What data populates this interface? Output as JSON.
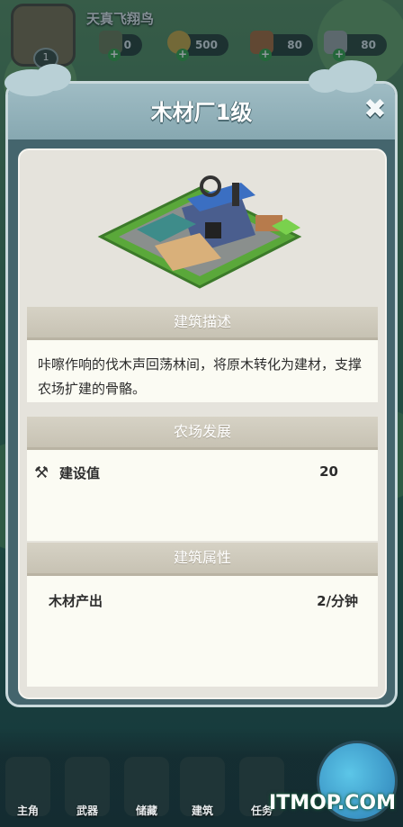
{
  "hud": {
    "player_name": "天真飞翔鸟",
    "level": "1",
    "resources": [
      {
        "icon": "bag-icon",
        "value": "0"
      },
      {
        "icon": "coin-icon",
        "value": "500"
      },
      {
        "icon": "wood-icon",
        "value": "80"
      },
      {
        "icon": "stone-icon",
        "value": "80"
      }
    ]
  },
  "modal": {
    "title": "木材厂1级",
    "close_icon": "close-icon",
    "sections": {
      "description": {
        "header": "建筑描述",
        "text": "咔嚓作响的伐木声回荡林间，将原木转化为建材，支撑农场扩建的骨骼。"
      },
      "development": {
        "header": "农场发展",
        "icon": "hammer-wrench-icon",
        "label": "建设值",
        "value": "20"
      },
      "attributes": {
        "header": "建筑属性",
        "label": "木材产出",
        "value": "2/分钟"
      }
    }
  },
  "nav": {
    "items": [
      "主角",
      "武器",
      "储藏",
      "建筑",
      "任务"
    ]
  },
  "watermark": "ITMOP.COM",
  "colors": {
    "panel_bg": "#e5e3dc",
    "section_header": "#c7c2b3",
    "modal_frame": "#44656d",
    "modal_head": "#9fbcc4"
  }
}
